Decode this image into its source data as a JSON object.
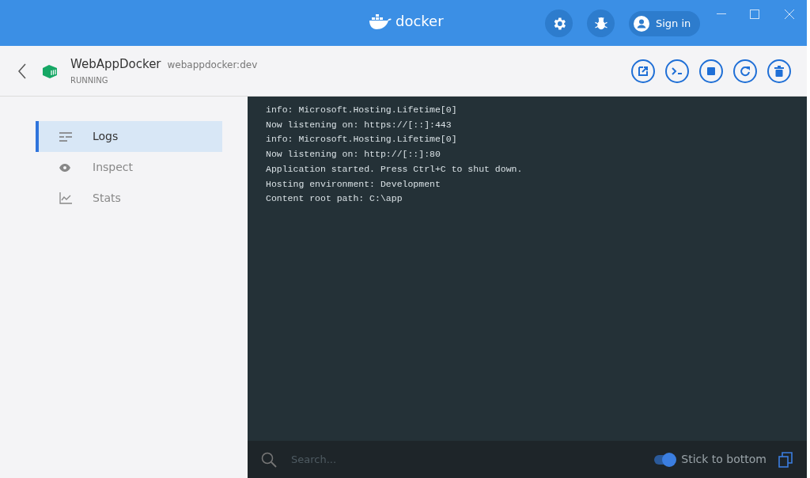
{
  "titlebar": {
    "logo": "docker",
    "sign_in": "Sign in"
  },
  "container": {
    "name": "WebAppDocker",
    "image": "webappdocker:dev",
    "status": "RUNNING"
  },
  "sidebar": {
    "items": [
      {
        "label": "Logs",
        "kind": "logs",
        "selected": true
      },
      {
        "label": "Inspect",
        "kind": "inspect",
        "selected": false
      },
      {
        "label": "Stats",
        "kind": "stats",
        "selected": false
      }
    ]
  },
  "logs": [
    "info: Microsoft.Hosting.Lifetime[0]",
    "Now listening on: https://[::]:443",
    "info: Microsoft.Hosting.Lifetime[0]",
    "Now listening on: http://[::]:80",
    "Application started. Press Ctrl+C to shut down.",
    "Hosting environment: Development",
    "Content root path: C:\\app"
  ],
  "footer": {
    "search": {
      "placeholder": "Search..."
    },
    "stick_to_bottom": {
      "label": "Stick to bottom",
      "on": true
    }
  }
}
